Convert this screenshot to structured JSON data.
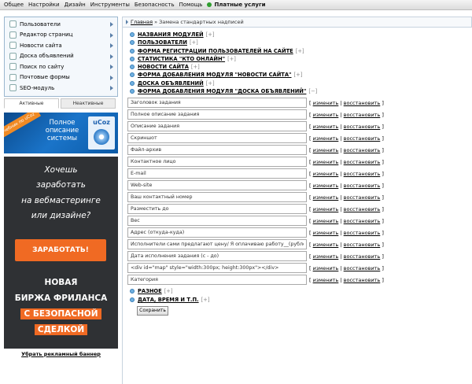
{
  "topmenu": {
    "items": [
      "Общее",
      "Настройки",
      "Дизайн",
      "Инструменты",
      "Безопасность",
      "Помощь"
    ],
    "paid": "Платные услуги"
  },
  "sidebar": {
    "items": [
      {
        "label": "Пользователи",
        "icon": "users-icon"
      },
      {
        "label": "Редактор страниц",
        "icon": "page-editor-icon"
      },
      {
        "label": "Новости сайта",
        "icon": "news-icon"
      },
      {
        "label": "Доска объявлений",
        "icon": "board-icon"
      },
      {
        "label": "Поиск по сайту",
        "icon": "search-icon"
      },
      {
        "label": "Почтовые формы",
        "icon": "mail-icon"
      },
      {
        "label": "SEO-модуль",
        "icon": "seo-icon"
      }
    ],
    "tabs": {
      "active": "Активные",
      "inactive": "Неактивные"
    }
  },
  "banners": {
    "ucoz": {
      "ribbon": "Учебник по uCoz",
      "text_line1": "Полное",
      "text_line2": "описание",
      "text_line3": "системы",
      "brand": "uCoz"
    },
    "freelance": {
      "head_line1": "Хочешь",
      "head_line2": "заработать",
      "head_line3": "на вебмастеринге",
      "head_line4": "или дизайне?",
      "button": "ЗАРАБОТАТЬ!",
      "line1": "НОВАЯ",
      "line2": "БИРЖА ФРИЛАНСА",
      "line3": "С БЕЗОПАСНОЙ",
      "line4": "СДЕЛКОЙ"
    },
    "remove_link": "Убрать рекламный баннер"
  },
  "breadcrumb": {
    "home": "Главная",
    "separator": "»",
    "current": "Замена стандартных надписей"
  },
  "sections_top": [
    {
      "title": "НАЗВАНИЯ МОДУЛЕЙ",
      "toggle": "[+]"
    },
    {
      "title": "ПОЛЬЗОВАТЕЛИ",
      "toggle": "[+]"
    },
    {
      "title": "ФОРМА РЕГИСТРАЦИИ ПОЛЬЗОВАТЕЛЕЙ НА САЙТЕ",
      "toggle": "[+]"
    },
    {
      "title": "СТАТИСТИКА \"КТО ОНЛАЙН\"",
      "toggle": "[+]"
    },
    {
      "title": "НОВОСТИ САЙТА",
      "toggle": "[+]"
    },
    {
      "title": "ФОРМА ДОБАВЛЕНИЯ МОДУЛЯ \"НОВОСТИ САЙТА\"",
      "toggle": "[+]"
    },
    {
      "title": "ДОСКА ОБЪЯВЛЕНИЙ",
      "toggle": "[+]"
    },
    {
      "title": "ФОРМА ДОБАВЛЕНИЯ МОДУЛЯ \"ДОСКА ОБЪЯВЛЕНИЙ\"",
      "toggle": "[−]"
    }
  ],
  "actions": {
    "edit": "изменить",
    "restore": "восстановить",
    "open": "[",
    "sep": "|",
    "close": "]"
  },
  "fields": [
    "Заголовок задания",
    "Полное описание задания",
    "Описание задания",
    "Скриншот",
    "Файл-архив",
    "Контактное лицо",
    "E-mail",
    "Web-site",
    "Ваш контактный номер",
    "Разместить до",
    "Вес",
    "Адрес (откуда-куда)",
    "Исполнители сами предлагают цену/ Я оплачиваю работу__(рублей)",
    "Дата исполнения задания (с - до)",
    "<div id=\"map\" style=\"width:300px; height:300px\"></div>",
    "Категория"
  ],
  "sections_bottom": [
    {
      "title": "РАЗНОЕ",
      "toggle": "[+]"
    },
    {
      "title": "ДАТА, ВРЕМЯ И Т.П.",
      "toggle": "[+]"
    }
  ],
  "save_label": "Сохранить",
  "colors": {
    "accent": "#f06a23",
    "menu_border": "#9bb7cf",
    "banner_dark": "#2f3134",
    "ucoz_blue": "#1a74c9"
  }
}
